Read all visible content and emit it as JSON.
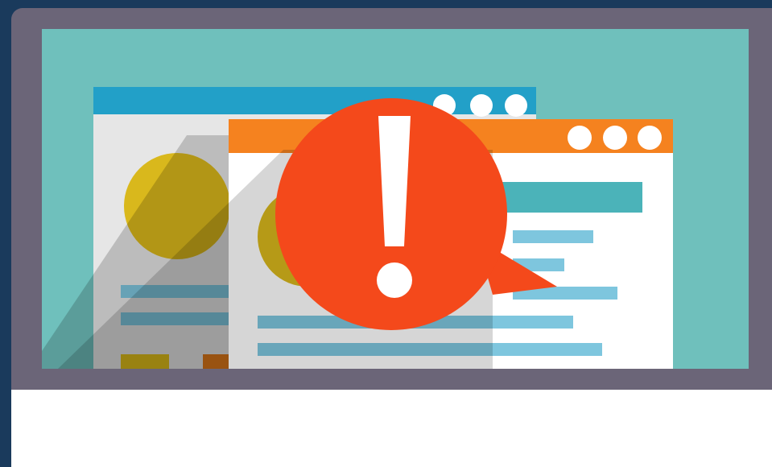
{
  "illustration": {
    "alert_icon": "exclamation-alert-icon",
    "colors": {
      "background": "#1a3a5c",
      "frame": "#6b6578",
      "screen": "#6fc0bc",
      "back_window_titlebar": "#22a0c8",
      "front_window_titlebar": "#f5821f",
      "alert_bubble": "#f4491b",
      "placeholder_circle": "#d9b81c",
      "text_line": "#7ec6de",
      "heading_bar": "#4bb3b9"
    },
    "back_window": {
      "dots": 3
    },
    "front_window": {
      "dots": 3
    }
  }
}
